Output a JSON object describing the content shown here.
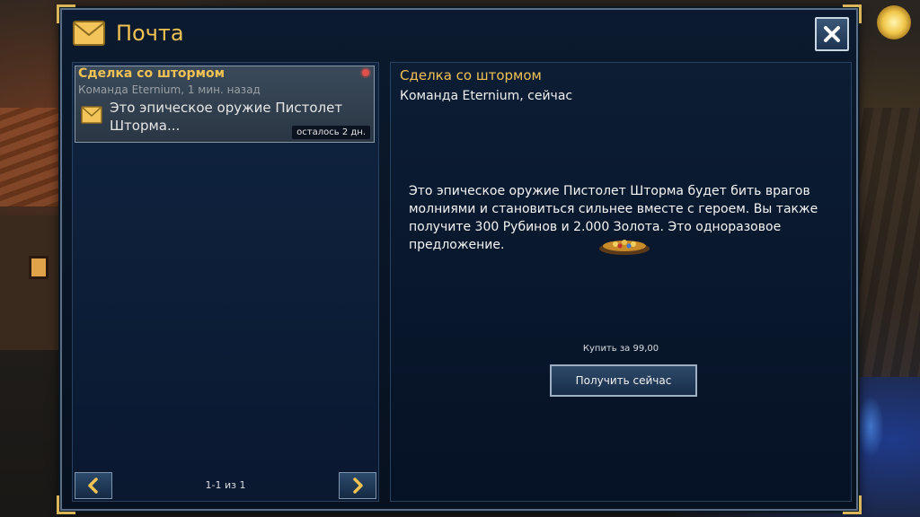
{
  "window": {
    "title": "Почта"
  },
  "mail_list": [
    {
      "subject": "Сделка со штормом",
      "sender_time": "Команда Eternium, 1 мин. назад",
      "preview": "Это эпическое оружие Пистолет Шторма...",
      "expiry": "осталось 2 дн.",
      "unread": true
    }
  ],
  "pager": {
    "info": "1-1 из 1"
  },
  "detail": {
    "subject": "Сделка со штормом",
    "sender_time": "Команда Eternium, сейчас",
    "body": "Это эпическое оружие Пистолет Шторма будет бить врагов молниями и становиться сильнее вместе с героем. Вы также получите 300 Рубинов и 2.000 Золота. Это одноразовое предложение.",
    "price_text": "Купить за 99,00",
    "buy_label": "Получить сейчас"
  },
  "icons": {
    "mail": "envelope-icon",
    "close": "close-icon",
    "prev": "chevron-left-icon",
    "next": "chevron-right-icon",
    "reward": "treasure-icon",
    "unread": "unread-dot-icon"
  },
  "colors": {
    "accent_gold": "#f0c254",
    "window_bg": "#0b1a2e",
    "unread_dot": "#e0504a"
  }
}
